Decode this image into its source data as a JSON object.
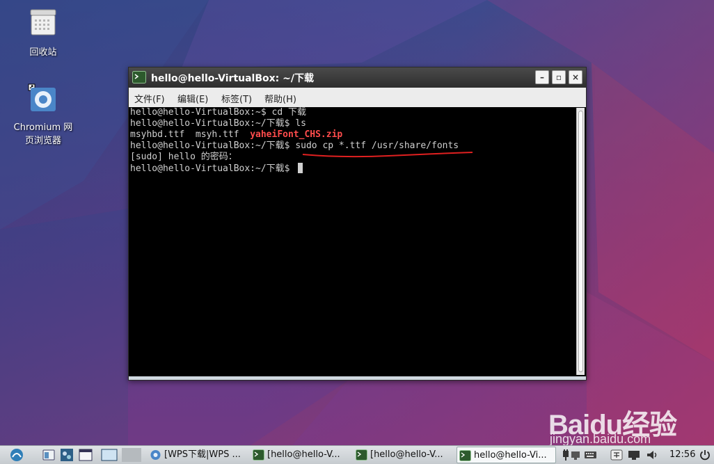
{
  "desktop": {
    "icons": [
      {
        "label": "回收站"
      },
      {
        "label": "Chromium 网\n页浏览器"
      }
    ]
  },
  "window": {
    "title": "hello@hello-VirtualBox: ~/下载",
    "buttons": {
      "minimize": "–",
      "maximize": "▫",
      "close": "×"
    },
    "menu": [
      "文件(F)",
      "编辑(E)",
      "标签(T)",
      "帮助(H)"
    ]
  },
  "terminal": {
    "lines": [
      "hello@hello-VirtualBox:~$ cd 下载",
      "hello@hello-VirtualBox:~/下载$ ls",
      "msyhbd.ttf  msyh.ttf  ",
      "hello@hello-VirtualBox:~/下载$ sudo cp *.ttf /usr/share/fonts",
      "[sudo] hello 的密码：",
      "hello@hello-VirtualBox:~/下载$ "
    ],
    "zip_file": "yaheiFont_CHS.zip"
  },
  "taskbar": {
    "tasks": [
      {
        "label": "[WPS下载|WPS ..."
      },
      {
        "label": "[hello@hello-V..."
      },
      {
        "label": "[hello@hello-V..."
      },
      {
        "label": "hello@hello-Vi..."
      }
    ],
    "clock": "12:56"
  },
  "watermark": {
    "logo": "Baidu经验",
    "url": "jingyan.baidu.com"
  },
  "colors": {
    "zip_highlight": "#ff4c4c",
    "underline": "#e02020",
    "terminal_bg": "#000000"
  }
}
